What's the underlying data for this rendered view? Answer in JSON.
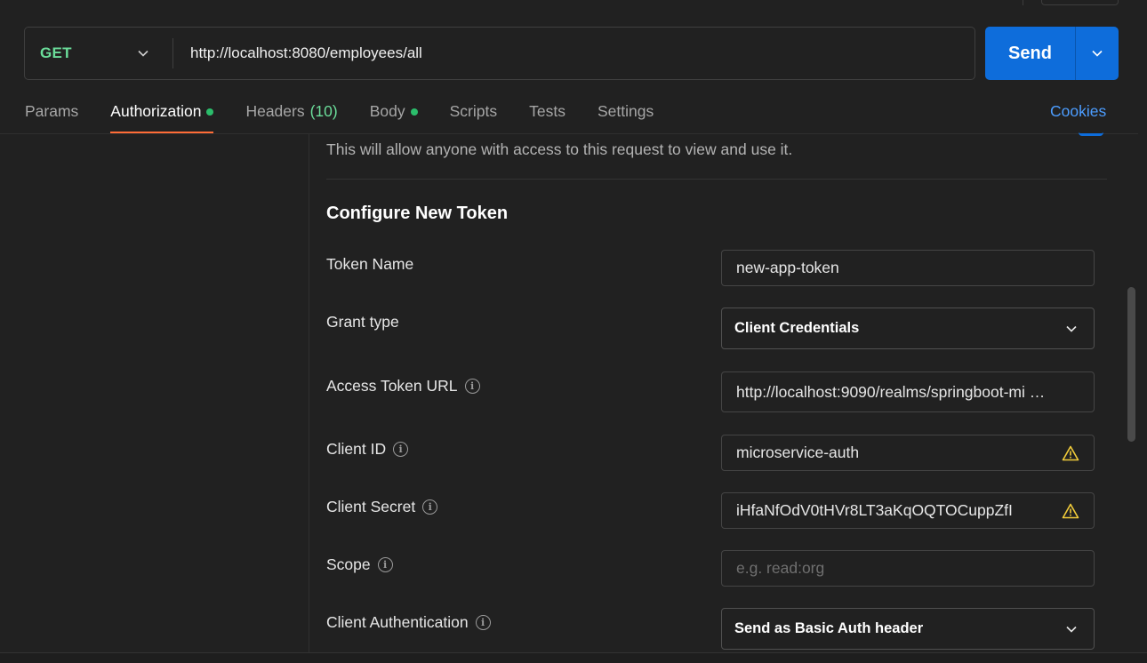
{
  "request": {
    "method": "GET",
    "url": "http://localhost:8080/employees/all",
    "send_label": "Send"
  },
  "tabs": [
    {
      "label": "Params"
    },
    {
      "label": "Authorization"
    },
    {
      "label": "Headers",
      "count": "(10)"
    },
    {
      "label": "Body"
    },
    {
      "label": "Scripts"
    },
    {
      "label": "Tests"
    },
    {
      "label": "Settings"
    }
  ],
  "cookies_label": "Cookies",
  "auth": {
    "notice": "This will allow anyone with access to this request to view and use it.",
    "section_title": "Configure New Token",
    "token_name": {
      "label": "Token Name",
      "value": "new-app-token"
    },
    "grant_type": {
      "label": "Grant type",
      "value": "Client Credentials"
    },
    "access_token_url": {
      "label": "Access Token URL",
      "value": "http://localhost:9090/realms/springboot-mi …"
    },
    "client_id": {
      "label": "Client ID",
      "value": "microservice-auth"
    },
    "client_secret": {
      "label": "Client Secret",
      "value": "iHfaNfOdV0tHVr8LT3aKqOQTOCuppZfI"
    },
    "scope": {
      "label": "Scope",
      "placeholder": "e.g. read:org"
    },
    "client_auth": {
      "label": "Client Authentication",
      "value": "Send as Basic Auth header"
    }
  },
  "colors": {
    "accent": "#0e6ddb",
    "method_get": "#6bdd9a",
    "active_tab_underline": "#ff6c37",
    "status_dot": "#2bbd6b",
    "link": "#4c9dff",
    "warning": "#f2cc3a"
  },
  "icons": {
    "info": "info-circle-icon",
    "warning": "warning-triangle-icon",
    "dropdown": "chevron-down-icon"
  }
}
